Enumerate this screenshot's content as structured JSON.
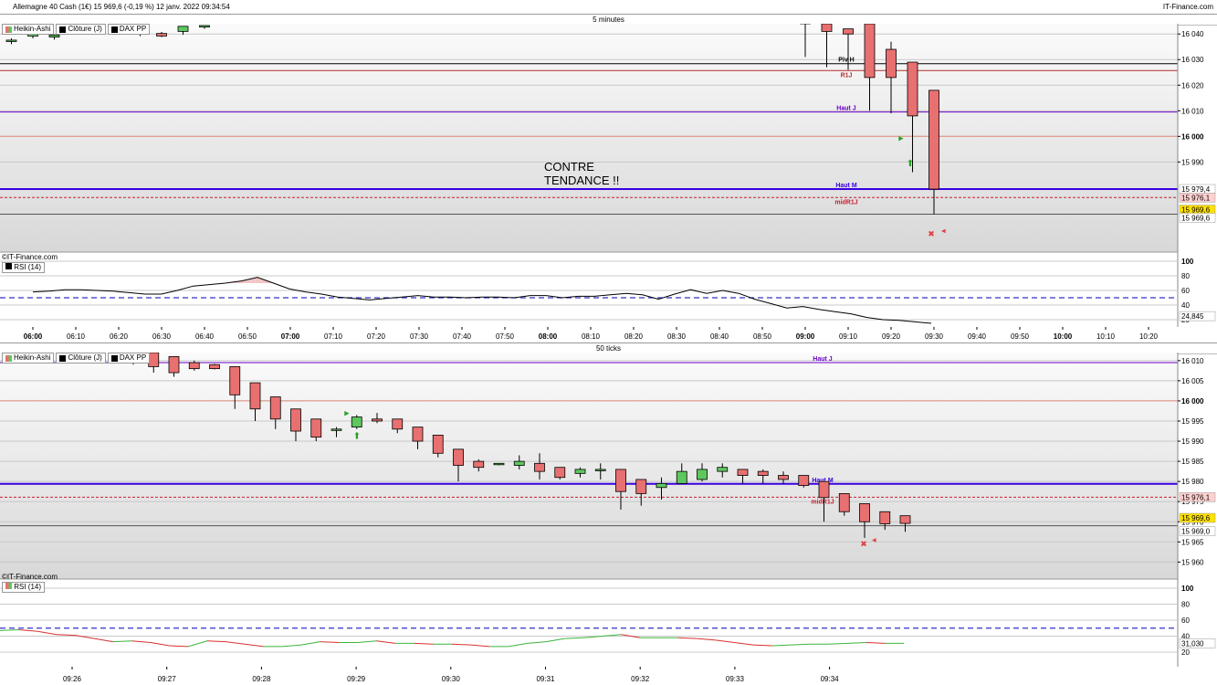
{
  "header": {
    "title": "Allemagne 40 Cash (1€) 15 969,6 (-0,19 %) 12 janv. 2022 09:34:54",
    "brand": "IT-Finance.com"
  },
  "legend": {
    "heikin": "Heikin-Ashi",
    "close": "Clôture (J)",
    "pivot": "DAX PP"
  },
  "watermark": "©IT-Finance.com",
  "rsi_label": "RSI (14)",
  "annotation": "CONTRE\nTENDANCE !!",
  "colors": {
    "up": "#5ec85e",
    "down": "#e87070",
    "pivot_line": "#000000",
    "resistance": "#b03030",
    "haut": "#6a00c8",
    "haut_m": "#3a00e0",
    "midr": "#c82030",
    "rsi_line": "#000000"
  },
  "chart_data": [
    {
      "type": "candlestick",
      "title": "5 minutes",
      "ylim": [
        15960.5,
        16044
      ],
      "y_ticks": [
        "16 040",
        "16 030",
        "16 020",
        "16 010",
        "16 000",
        "15 990"
      ],
      "x_ticks": [
        "06:00",
        "06:10",
        "06:20",
        "06:30",
        "06:40",
        "06:50",
        "07:00",
        "07:10",
        "07:20",
        "07:30",
        "07:40",
        "07:50",
        "08:00",
        "08:10",
        "08:20",
        "08:30",
        "08:40",
        "08:50",
        "09:00",
        "09:10",
        "09:20",
        "09:30",
        "09:40",
        "09:50",
        "10:00",
        "10:10",
        "10:20"
      ],
      "x_ticks_bold": [
        "06:00",
        "07:00",
        "08:00",
        "09:00",
        "10:00"
      ],
      "candles": [
        {
          "t": "05:55",
          "o": 16037.6,
          "h": 16038.3,
          "l": 16036.0,
          "c": 16037.6
        },
        {
          "t": "06:00",
          "o": 16039.2,
          "h": 16040.0,
          "l": 16038.3,
          "c": 16040.0
        },
        {
          "t": "06:05",
          "o": 16038.8,
          "h": 16039.8,
          "l": 16037.8,
          "c": 16039.6
        },
        {
          "t": "06:25",
          "o": 16040.7,
          "h": 16041.3,
          "l": 16039.2,
          "c": 16040.2
        },
        {
          "t": "06:30",
          "o": 16040.2,
          "h": 16040.8,
          "l": 16038.8,
          "c": 16039.2
        },
        {
          "t": "06:35",
          "o": 16041.0,
          "h": 16043.0,
          "l": 16039.7,
          "c": 16043.0
        },
        {
          "t": "06:40",
          "o": 16042.7,
          "h": 16043.3,
          "l": 16042.0,
          "c": 16043.3
        },
        {
          "t": "09:00",
          "o": 16046.0,
          "h": 16046.0,
          "l": 16031.0,
          "c": 16044.0
        },
        {
          "t": "09:05",
          "o": 16044.0,
          "h": 16044.0,
          "l": 16027.0,
          "c": 16041.0
        },
        {
          "t": "09:10",
          "o": 16042.0,
          "h": 16042.0,
          "l": 16026.0,
          "c": 16040.0
        },
        {
          "t": "09:15",
          "o": 16044.0,
          "h": 16044.0,
          "l": 16010.0,
          "c": 16023.0
        },
        {
          "t": "09:20",
          "o": 16034.0,
          "h": 16037.0,
          "l": 16009.0,
          "c": 16023.0
        },
        {
          "t": "09:25",
          "o": 16029.0,
          "h": 16029.0,
          "l": 15986.0,
          "c": 16008.0
        },
        {
          "t": "09:30",
          "o": 16018.0,
          "h": 16018.0,
          "l": 15969.6,
          "c": 15979.4
        }
      ],
      "levels": [
        {
          "name": "Piv H",
          "value": 16028.4,
          "color": "#000000"
        },
        {
          "name": "R1J",
          "value": 16025.7,
          "color": "#b03030"
        },
        {
          "name": "Haut J",
          "value": 16009.5,
          "color": "#6a00c8"
        },
        {
          "name": "",
          "value": 16000,
          "color": "#e08a7a"
        },
        {
          "name": "Haut M",
          "value": 15979.4,
          "color": "#3a00e0"
        },
        {
          "name": "midR1J",
          "value": 15976.1,
          "color": "#c82030"
        }
      ],
      "price_tags": [
        "15 979,4",
        "15 976,1",
        "15 969,6",
        "15 969,6"
      ],
      "close_line": 15969.6
    },
    {
      "type": "candlestick",
      "title": "50 ticks",
      "ylim": [
        15958.5,
        16012
      ],
      "y_ticks": [
        "16 010",
        "16 005",
        "16 000",
        "15 995",
        "15 990",
        "15 985",
        "15 980",
        "15 975",
        "15 970",
        "15 965",
        "15 960"
      ],
      "x_ticks": [
        "09:26",
        "09:27",
        "09:28",
        "09:29",
        "09:30",
        "09:31",
        "09:32",
        "09:33",
        "09:34"
      ],
      "candles": [
        {
          "o": 16013.0,
          "h": 16013.0,
          "l": 16009.0,
          "c": 16011.0
        },
        {
          "o": 16012.0,
          "h": 16012.0,
          "l": 16007.0,
          "c": 16008.5
        },
        {
          "o": 16011.0,
          "h": 16011.0,
          "l": 16006.0,
          "c": 16007.0
        },
        {
          "o": 16009.5,
          "h": 16010.0,
          "l": 16007.5,
          "c": 16008.0
        },
        {
          "o": 16009.0,
          "h": 16009.2,
          "l": 16007.8,
          "c": 16008.0
        },
        {
          "o": 16008.5,
          "h": 16008.5,
          "l": 15998.0,
          "c": 16001.5
        },
        {
          "o": 16004.5,
          "h": 16004.5,
          "l": 15995.0,
          "c": 15998.0
        },
        {
          "o": 16001.0,
          "h": 16001.0,
          "l": 15993.0,
          "c": 15995.5
        },
        {
          "o": 15998.0,
          "h": 15998.0,
          "l": 15990.0,
          "c": 15992.5
        },
        {
          "o": 15995.5,
          "h": 15995.5,
          "l": 15990.0,
          "c": 15991.0
        },
        {
          "o": 15993.0,
          "h": 15993.5,
          "l": 15991.0,
          "c": 15993.0
        },
        {
          "o": 15993.5,
          "h": 15996.5,
          "l": 15993.0,
          "c": 15996.0
        },
        {
          "o": 15995.5,
          "h": 15997.0,
          "l": 15994.5,
          "c": 15995.0
        },
        {
          "o": 15995.5,
          "h": 15995.5,
          "l": 15992.0,
          "c": 15993.0
        },
        {
          "o": 15993.5,
          "h": 15993.5,
          "l": 15988.0,
          "c": 15990.0
        },
        {
          "o": 15991.5,
          "h": 15991.5,
          "l": 15986.0,
          "c": 15987.0
        },
        {
          "o": 15988.0,
          "h": 15988.0,
          "l": 15980.0,
          "c": 15984.0
        },
        {
          "o": 15985.0,
          "h": 15985.5,
          "l": 15982.5,
          "c": 15983.5
        },
        {
          "o": 15984.5,
          "h": 15984.5,
          "l": 15984.0,
          "c": 15984.5
        },
        {
          "o": 15984.0,
          "h": 15986.5,
          "l": 15983.0,
          "c": 15985.0
        },
        {
          "o": 15984.5,
          "h": 15987.0,
          "l": 15980.5,
          "c": 15982.5
        },
        {
          "o": 15983.5,
          "h": 15983.5,
          "l": 15980.5,
          "c": 15981.0
        },
        {
          "o": 15982.0,
          "h": 15983.5,
          "l": 15981.0,
          "c": 15983.0
        },
        {
          "o": 15983.0,
          "h": 15984.5,
          "l": 15980.5,
          "c": 15983.0
        },
        {
          "o": 15983.0,
          "h": 15983.0,
          "l": 15973.0,
          "c": 15977.5
        },
        {
          "o": 15980.5,
          "h": 15980.5,
          "l": 15974.0,
          "c": 15977.0
        },
        {
          "o": 15978.5,
          "h": 15981.0,
          "l": 15975.5,
          "c": 15979.5
        },
        {
          "o": 15979.5,
          "h": 15984.5,
          "l": 15979.5,
          "c": 15982.5
        },
        {
          "o": 15980.5,
          "h": 15984.5,
          "l": 15980.0,
          "c": 15983.0
        },
        {
          "o": 15982.5,
          "h": 15984.5,
          "l": 15981.0,
          "c": 15983.5
        },
        {
          "o": 15983.0,
          "h": 15983.0,
          "l": 15979.5,
          "c": 15981.5
        },
        {
          "o": 15982.5,
          "h": 15983.0,
          "l": 15979.5,
          "c": 15981.5
        },
        {
          "o": 15981.5,
          "h": 15982.5,
          "l": 15979.5,
          "c": 15980.5
        },
        {
          "o": 15981.5,
          "h": 15981.5,
          "l": 15978.5,
          "c": 15979.0
        },
        {
          "o": 15980.0,
          "h": 15980.0,
          "l": 15970.0,
          "c": 15976.0
        },
        {
          "o": 15977.0,
          "h": 15977.0,
          "l": 15971.5,
          "c": 15972.5
        },
        {
          "o": 15974.5,
          "h": 15974.5,
          "l": 15966.0,
          "c": 15970.0
        },
        {
          "o": 15972.5,
          "h": 15972.5,
          "l": 15968.0,
          "c": 15969.5
        },
        {
          "o": 15971.5,
          "h": 15971.5,
          "l": 15967.5,
          "c": 15969.6
        }
      ],
      "levels": [
        {
          "name": "Haut J",
          "value": 16009.5,
          "color": "#6a00c8"
        },
        {
          "name": "",
          "value": 16000,
          "color": "#e08a7a"
        },
        {
          "name": "Haut M",
          "value": 15979.4,
          "color": "#3a00e0"
        },
        {
          "name": "midR1J",
          "value": 15976.1,
          "color": "#c82030"
        }
      ],
      "price_tags": [
        "15 976,1",
        "15 969,6",
        "15 969,0"
      ],
      "close_line": 15969.0
    },
    {
      "type": "line",
      "title": "RSI (14)",
      "ylim": [
        15,
        100
      ],
      "y_ticks": [
        "100",
        "80",
        "60",
        "40",
        "20"
      ],
      "levels": [
        50
      ],
      "series": [
        {
          "name": "RSI (14)",
          "values": [
            58,
            59,
            61,
            61,
            60,
            59,
            57,
            55,
            55,
            60,
            66,
            68,
            70,
            73,
            78,
            70,
            62,
            58,
            55,
            51,
            49,
            47,
            49,
            51,
            53,
            51,
            51,
            50,
            51,
            51,
            50,
            53,
            53,
            50,
            52,
            52,
            54,
            56,
            54,
            48,
            55,
            61,
            56,
            60,
            56,
            48,
            42,
            36,
            38,
            34,
            31,
            28,
            23,
            20,
            19,
            17,
            15
          ]
        }
      ],
      "last_value": "24,845"
    },
    {
      "type": "line",
      "title": "RSI (14)",
      "ylim": [
        15,
        100
      ],
      "y_ticks": [
        "100",
        "80",
        "60",
        "40",
        "20"
      ],
      "levels": [
        50
      ],
      "series": [
        {
          "name": "RSI (14)",
          "values": [
            47,
            48,
            46,
            42,
            41,
            37,
            33,
            34,
            32,
            28,
            27,
            34,
            33,
            30,
            27,
            27,
            29,
            33,
            32,
            32,
            34,
            31,
            31,
            30,
            30,
            29,
            27,
            27,
            31,
            33,
            37,
            38,
            40,
            42,
            38,
            38,
            38,
            37,
            35,
            32,
            29,
            28,
            29,
            30,
            30,
            31,
            32,
            31,
            31
          ]
        }
      ],
      "last_value": "31,030"
    }
  ]
}
